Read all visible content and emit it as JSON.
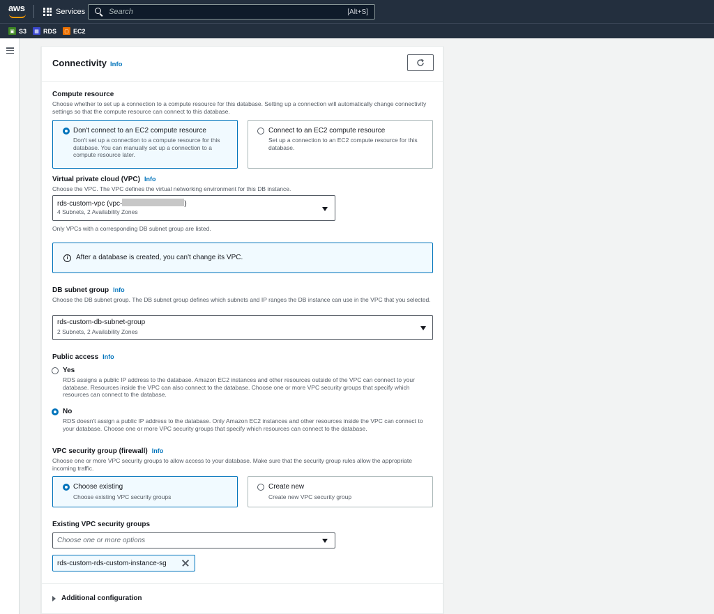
{
  "topbar": {
    "logo_text": "aws",
    "services_label": "Services",
    "search_placeholder": "Search",
    "search_shortcut": "[Alt+S]"
  },
  "favorites": [
    {
      "label": "S3",
      "icon": "s3-icon"
    },
    {
      "label": "RDS",
      "icon": "rds-icon"
    },
    {
      "label": "EC2",
      "icon": "ec2-icon"
    }
  ],
  "panel": {
    "title": "Connectivity",
    "info": "Info"
  },
  "compute": {
    "label": "Compute resource",
    "description": "Choose whether to set up a connection to a compute resource for this database. Setting up a connection will automatically change connectivity settings so that the compute resource can connect to this database.",
    "options": [
      {
        "title": "Don't connect to an EC2 compute resource",
        "description": "Don't set up a connection to a compute resource for this database. You can manually set up a connection to a compute resource later.",
        "selected": true
      },
      {
        "title": "Connect to an EC2 compute resource",
        "description": "Set up a connection to an EC2 compute resource for this database.",
        "selected": false
      }
    ]
  },
  "vpc": {
    "label": "Virtual private cloud (VPC)",
    "info": "Info",
    "description": "Choose the VPC. The VPC defines the virtual networking environment for this DB instance.",
    "value_prefix": "rds-custom-vpc (vpc-",
    "value_suffix": ")",
    "value_sub": "4 Subnets, 2 Availability Zones",
    "hint": "Only VPCs with a corresponding DB subnet group are listed."
  },
  "alert": {
    "text": "After a database is created, you can't change its VPC."
  },
  "subnet": {
    "label": "DB subnet group",
    "info": "Info",
    "description": "Choose the DB subnet group. The DB subnet group defines which subnets and IP ranges the DB instance can use in the VPC that you selected.",
    "value": "rds-custom-db-subnet-group",
    "value_sub": "2 Subnets, 2 Availability Zones"
  },
  "public_access": {
    "label": "Public access",
    "info": "Info",
    "options": [
      {
        "title": "Yes",
        "description": "RDS assigns a public IP address to the database. Amazon EC2 instances and other resources outside of the VPC can connect to your database. Resources inside the VPC can also connect to the database. Choose one or more VPC security groups that specify which resources can connect to the database.",
        "selected": false
      },
      {
        "title": "No",
        "description": "RDS doesn't assign a public IP address to the database. Only Amazon EC2 instances and other resources inside the VPC can connect to your database. Choose one or more VPC security groups that specify which resources can connect to the database.",
        "selected": true
      }
    ]
  },
  "security_group": {
    "label": "VPC security group (firewall)",
    "info": "Info",
    "description": "Choose one or more VPC security groups to allow access to your database. Make sure that the security group rules allow the appropriate incoming traffic.",
    "options": [
      {
        "title": "Choose existing",
        "description": "Choose existing VPC security groups",
        "selected": true
      },
      {
        "title": "Create new",
        "description": "Create new VPC security group",
        "selected": false
      }
    ]
  },
  "existing_groups": {
    "label": "Existing VPC security groups",
    "placeholder": "Choose one or more options",
    "tokens": [
      "rds-custom-rds-custom-instance-sg"
    ]
  },
  "additional": {
    "label": "Additional configuration"
  }
}
